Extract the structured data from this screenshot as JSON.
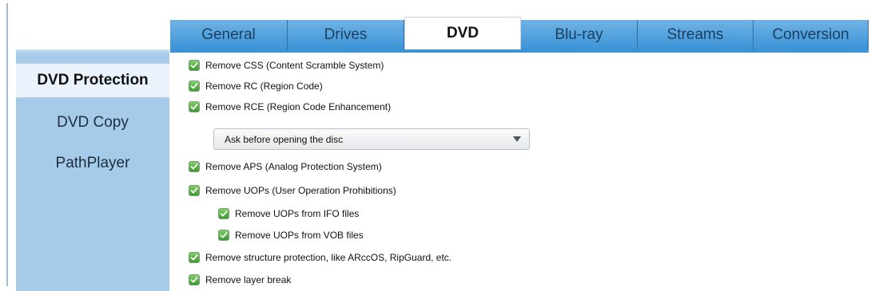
{
  "tabs": [
    {
      "label": "General",
      "active": false
    },
    {
      "label": "Drives",
      "active": false
    },
    {
      "label": "DVD",
      "active": true
    },
    {
      "label": "Blu-ray",
      "active": false
    },
    {
      "label": "Streams",
      "active": false
    },
    {
      "label": "Conversion",
      "active": false
    }
  ],
  "sidebar": {
    "items": [
      {
        "label": "DVD Protection",
        "active": true
      },
      {
        "label": "DVD Copy",
        "active": false
      },
      {
        "label": "PathPlayer",
        "active": false
      }
    ]
  },
  "options": {
    "remove_css": {
      "label": "Remove CSS (Content Scramble System)",
      "checked": true
    },
    "remove_rc": {
      "label": "Remove RC (Region Code)",
      "checked": true
    },
    "remove_rce": {
      "label": "Remove RCE (Region Code Enhancement)",
      "checked": true
    },
    "rce_mode": {
      "value": "Ask before opening the disc"
    },
    "remove_aps": {
      "label": "Remove APS (Analog Protection System)",
      "checked": true
    },
    "remove_uops": {
      "label": "Remove UOPs (User Operation Prohibitions)",
      "checked": true
    },
    "remove_uops_ifo": {
      "label": "Remove UOPs from IFO files",
      "checked": true
    },
    "remove_uops_vob": {
      "label": "Remove UOPs from VOB files",
      "checked": true
    },
    "remove_structure": {
      "label": "Remove structure protection, like ARccOS, RipGuard, etc.",
      "checked": true
    },
    "remove_layer_break": {
      "label": "Remove layer break",
      "checked": true
    }
  },
  "colors": {
    "tab_bg": "#3c93d6",
    "sidebar_bg": "#a6cbe9",
    "checkbox_green": "#3e9a2e"
  }
}
